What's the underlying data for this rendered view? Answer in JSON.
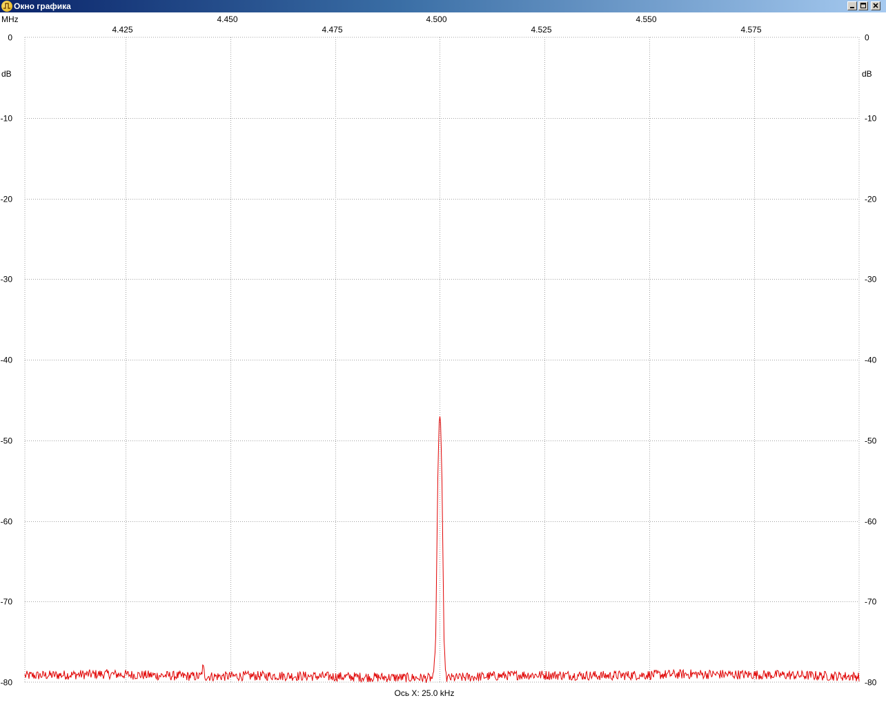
{
  "window": {
    "title": "Окно графика"
  },
  "chart_data": {
    "type": "line",
    "x_unit_label": "MHz",
    "y_unit_label": "dB",
    "x_range": [
      4.401,
      4.6
    ],
    "xlim": [
      4.401,
      4.6
    ],
    "ylim": [
      -80,
      0
    ],
    "x_ticks_upper": [
      4.45,
      4.5,
      4.55
    ],
    "x_ticks_lower": [
      4.425,
      4.475,
      4.525,
      4.575
    ],
    "x_tick_labels_upper": [
      "4.450",
      "4.500",
      "4.550"
    ],
    "x_tick_labels_lower": [
      "4.425",
      "4.475",
      "4.525",
      "4.575"
    ],
    "y_ticks": [
      0,
      -10,
      -20,
      -30,
      -40,
      -50,
      -60,
      -70,
      -80
    ],
    "y_tick_labels": [
      "0",
      "-10",
      "-20",
      "-30",
      "-40",
      "-50",
      "-60",
      "-70",
      "-80"
    ],
    "x_axis_caption": "Ось X: 25.0 kHz",
    "grid": true,
    "line_color": "#e00000",
    "series": [
      {
        "noise_floor_db": -79.2,
        "noise_amplitude_db": 0.6,
        "x": [
          4.401,
          4.42,
          4.443,
          4.4435,
          4.444,
          4.46,
          4.4985,
          4.499,
          4.4995,
          4.4998,
          4.5,
          4.5002,
          4.5005,
          4.501,
          4.5015,
          4.52,
          4.54,
          4.56,
          4.58,
          4.6
        ],
        "y": [
          -79.2,
          -79.0,
          -79.3,
          -78.1,
          -79.3,
          -79.2,
          -79.5,
          -75.0,
          -55.0,
          -48.0,
          -47.0,
          -48.0,
          -55.0,
          -75.0,
          -79.5,
          -79.1,
          -79.2,
          -79.0,
          -79.1,
          -79.3
        ]
      }
    ]
  }
}
